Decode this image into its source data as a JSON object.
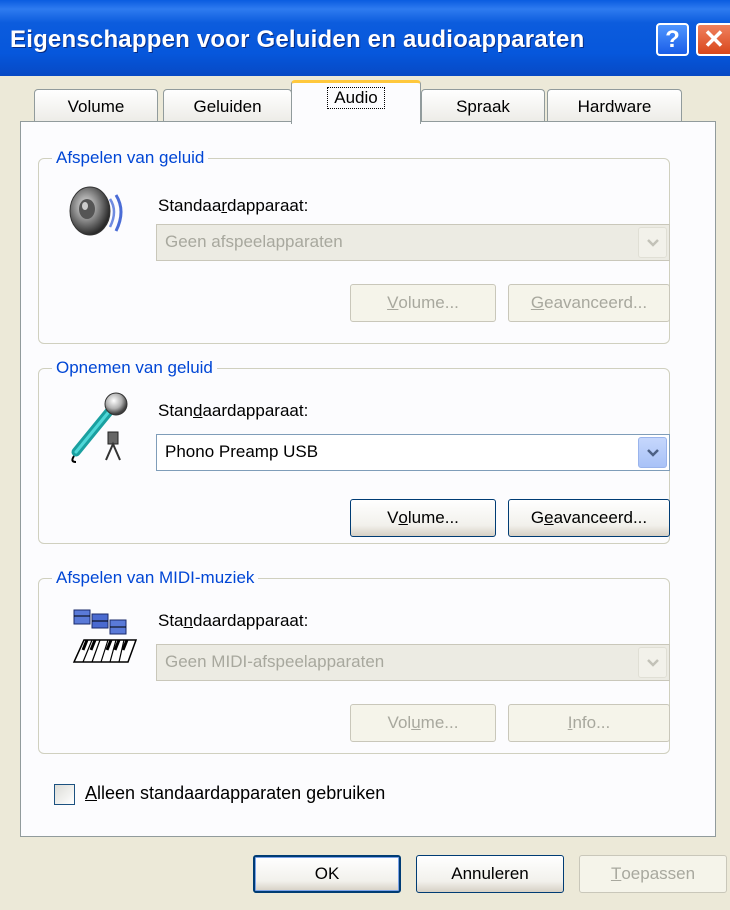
{
  "window": {
    "title": "Eigenschappen voor Geluiden en audioapparaten",
    "help_glyph": "?",
    "close_glyph": "✕"
  },
  "tabs": [
    {
      "label": "Volume"
    },
    {
      "label": "Geluiden"
    },
    {
      "label": "Audio",
      "active": true
    },
    {
      "label": "Spraak"
    },
    {
      "label": "Hardware"
    }
  ],
  "playback": {
    "group_label": "Afspelen van geluid",
    "icon": "speaker-icon",
    "field_label_pre": "Standaa",
    "field_label_acc": "r",
    "field_label_post": "dapparaat:",
    "device": "Geen afspeelapparaten",
    "volume_pre": "",
    "volume_acc": "V",
    "volume_post": "olume...",
    "advanced_pre": "",
    "advanced_acc": "G",
    "advanced_post": "eavanceerd..."
  },
  "recording": {
    "group_label": "Opnemen van geluid",
    "icon": "microphone-icon",
    "field_label_pre": "Stan",
    "field_label_acc": "d",
    "field_label_post": "aardapparaat:",
    "device": "Phono Preamp USB",
    "volume_pre": "V",
    "volume_acc": "o",
    "volume_post": "lume...",
    "advanced_pre": "G",
    "advanced_acc": "e",
    "advanced_post": "avanceerd..."
  },
  "midi": {
    "group_label": "Afspelen van MIDI-muziek",
    "icon": "midi-keyboard-icon",
    "field_label_pre": "Sta",
    "field_label_acc": "n",
    "field_label_post": "daardapparaat:",
    "device": "Geen MIDI-afspeelapparaten",
    "volume_pre": "Vol",
    "volume_acc": "u",
    "volume_post": "me...",
    "info_pre": "",
    "info_acc": "I",
    "info_post": "nfo..."
  },
  "only_default": {
    "acc": "A",
    "post": "lleen standaardapparaten gebruiken",
    "checked": false
  },
  "buttons": {
    "ok": "OK",
    "cancel": "Annuleren",
    "apply_acc": "T",
    "apply_post": "oepassen"
  },
  "colors": {
    "titlebar": "#0657DC",
    "group_label": "#0046D5",
    "tab_highlight": "#FFC83C",
    "dialog_bg": "#ECE9D8",
    "panel_bg": "#FCFCFE"
  }
}
